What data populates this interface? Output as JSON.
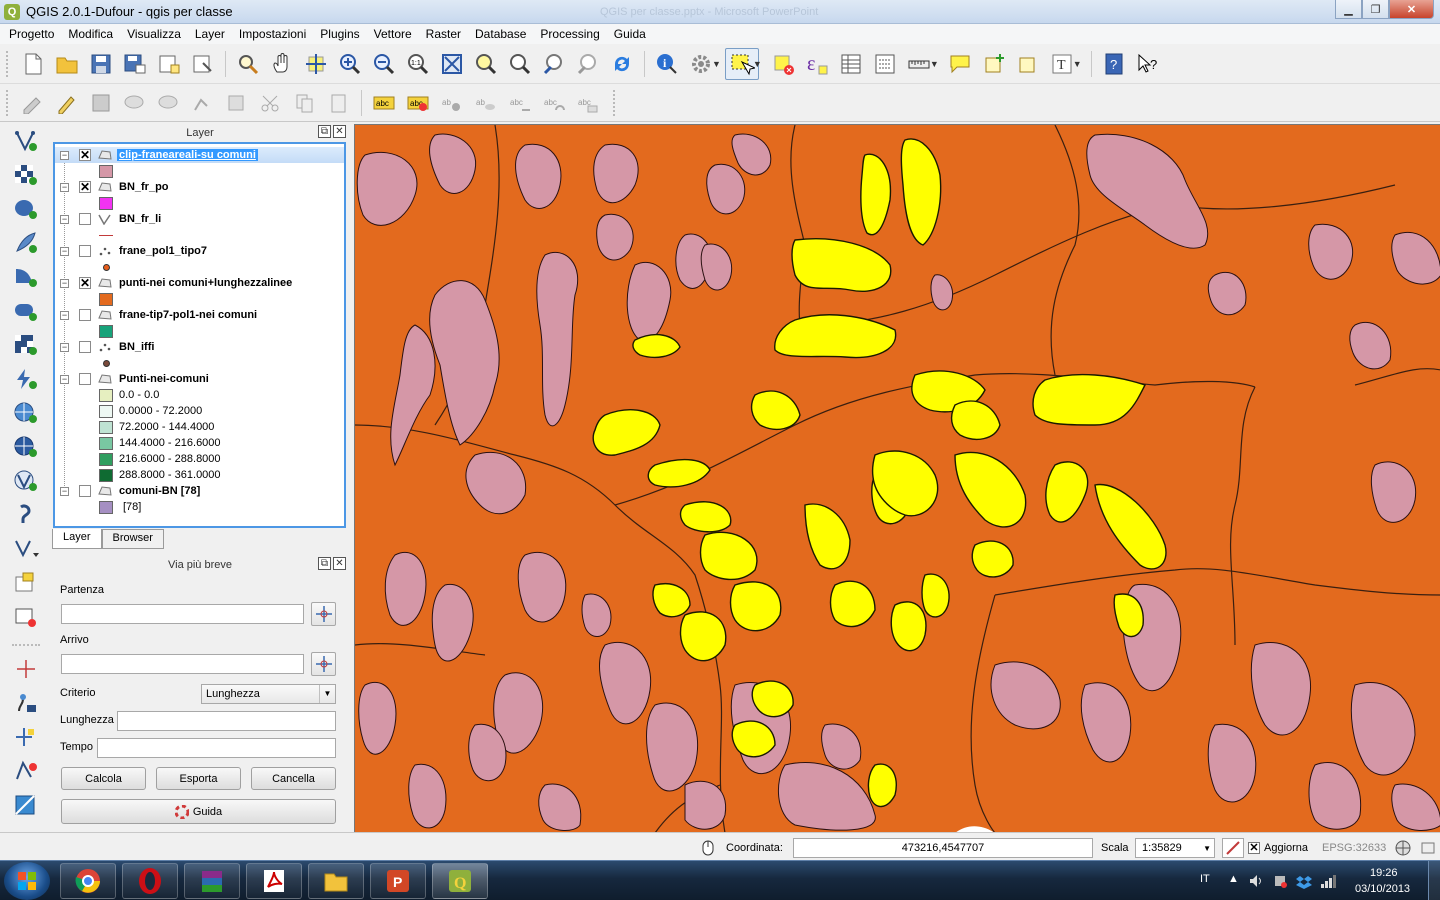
{
  "window": {
    "title": "QGIS 2.0.1-Dufour - qgis per classe",
    "background_title": "QGIS per classe.pptx - Microsoft PowerPoint",
    "minimize": "▁",
    "restore": "❐",
    "close": "✕"
  },
  "menu": [
    "Progetto",
    "Modifica",
    "Visualizza",
    "Layer",
    "Impostazioni",
    "Plugins",
    "Vettore",
    "Raster",
    "Database",
    "Processing",
    "Guida"
  ],
  "layers_panel": {
    "title": "Layer",
    "layers": [
      {
        "name": "clip-franeareali-su comuni",
        "checked": "✕",
        "swatch": "#d597a7"
      },
      {
        "name": "BN_fr_po",
        "checked": "✕",
        "swatch": "#f233f2"
      },
      {
        "name": "BN_fr_li",
        "checked": "",
        "swatch": "#c23a3a"
      },
      {
        "name": "frane_pol1_tipo7",
        "checked": "",
        "swatch": "#e85e1c"
      },
      {
        "name": "punti-nei comuni+lunghezzalinee",
        "checked": "✕",
        "swatch": "#e36a1e"
      },
      {
        "name": "frane-tip7-pol1-nei comuni",
        "checked": "",
        "swatch": "#17a37a"
      },
      {
        "name": "BN_iffi",
        "checked": "",
        "swatch": "#7a4a3a"
      },
      {
        "name": "Punti-nei-comuni",
        "checked": "",
        "swatch": ""
      },
      {
        "name": "comuni-BN [78]",
        "checked": "",
        "swatch": "#a58fc2"
      }
    ],
    "classes": [
      {
        "label": "0.0 - 0.0",
        "color": "#e6efc0"
      },
      {
        "label": "0.0000 - 72.2000",
        "color": "#eef8f3"
      },
      {
        "label": "72.2000 - 144.4000",
        "color": "#bfe3d3"
      },
      {
        "label": "144.4000 - 216.6000",
        "color": "#79c7a2"
      },
      {
        "label": "216.6000 - 288.8000",
        "color": "#2f9e5f"
      },
      {
        "label": "288.8000 - 361.0000",
        "color": "#0f6b32"
      }
    ],
    "comuni_sub": "[78]",
    "tabs": [
      "Layer",
      "Browser"
    ]
  },
  "path_panel": {
    "title": "Via più breve",
    "start_label": "Partenza",
    "start_value": "",
    "end_label": "Arrivo",
    "end_value": "",
    "criterion_label": "Criterio",
    "criterion_value": "Lunghezza",
    "length_label": "Lunghezza",
    "length_value": "",
    "time_label": "Tempo",
    "time_value": "",
    "calc": "Calcola",
    "export": "Esporta",
    "clear": "Cancella",
    "help": "Guida"
  },
  "status": {
    "coord_label": "Coordinata:",
    "coord_value": "473216,4547707",
    "scale_label": "Scala",
    "scale_value": "1:35829",
    "update_label": "Aggiorna",
    "epsg": "EPSG:32633"
  },
  "taskbar": {
    "lang": "IT",
    "time": "19:26",
    "date": "03/10/2013"
  },
  "colors": {
    "map_background": "#e36a1e",
    "landslide_pink": "#d597a7",
    "landslide_yellow": "#ffff00",
    "selection_blue": "#3399ff"
  }
}
